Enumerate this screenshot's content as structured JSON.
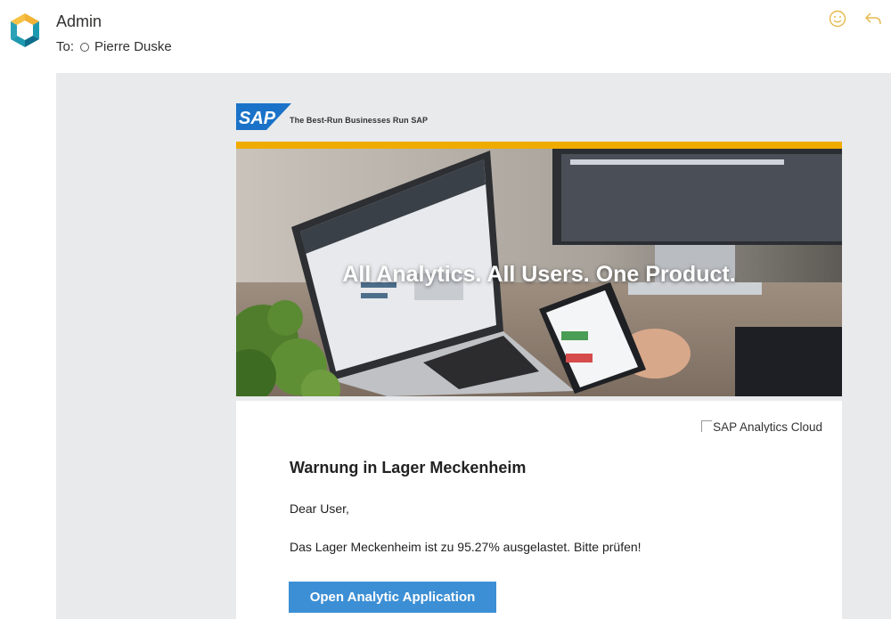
{
  "header": {
    "sender_name": "Admin",
    "to_label": "To:",
    "recipient": "Pierre Duske",
    "icons": [
      "app-logo-icon",
      "emoji-icon",
      "reply-icon"
    ]
  },
  "email": {
    "sap_logo_text": "SAP",
    "sap_tagline": "The Best-Run Businesses Run SAP",
    "hero_tagline": "All Analytics. All Users. One Product.",
    "broken_image_alt": "SAP Analytics Cloud",
    "warning_title": "Warnung in Lager Meckenheim",
    "greeting": "Dear User,",
    "message": "Das Lager Meckenheim ist zu 95.27% ausgelastet. Bitte prüfen!",
    "cta_label": "Open Analytic Application"
  },
  "colors": {
    "sap_blue": "#1a73c8",
    "gold": "#f0ab00",
    "button": "#3c8fd4",
    "body_bg": "#e9eaec",
    "icon_gold": "#e6b94c"
  }
}
